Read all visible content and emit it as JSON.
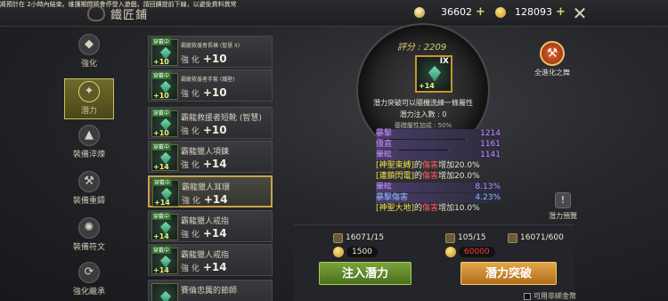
{
  "notice": "將預計在 2小時內結束。維護期間將會停發入遊戲，請回饋提前下線，以避免資料異常",
  "shop_title": "鐵匠鋪",
  "currency": {
    "silver": "36602",
    "gold": "128093"
  },
  "nav": [
    {
      "label": "強化",
      "icon": "gem-icon"
    },
    {
      "label": "潛力",
      "icon": "potential-icon"
    },
    {
      "label": "裝備淬煉",
      "icon": "anvil-icon"
    },
    {
      "label": "裝備重鑄",
      "icon": "hammer-icon"
    },
    {
      "label": "裝備符文",
      "icon": "rune-icon"
    },
    {
      "label": "強化繼承",
      "icon": "inherit-icon"
    }
  ],
  "list": [
    {
      "badge": "穿戴中",
      "lv": "+10",
      "name": "霸龍救援者長褲 (智慧 II)",
      "value_label": "強 化",
      "value": "+10"
    },
    {
      "badge": "穿戴中",
      "lv": "+10",
      "name": "霸龍救援者手套 (鐵壁)",
      "value_label": "強 化",
      "value": "+10"
    },
    {
      "badge": "穿戴中",
      "lv": "+10",
      "name": "霸龍救援者短靴 (智慧)",
      "value_label": "強 化",
      "value": "+10"
    },
    {
      "badge": "穿戴中",
      "lv": "+14",
      "name": "霸龍獵人項鍊",
      "value_label": "強 化",
      "value": "+14"
    },
    {
      "badge": "穿戴中",
      "lv": "+14",
      "name": "霸龍獵人耳環",
      "value_label": "強 化",
      "value": "+14"
    },
    {
      "badge": "穿戴中",
      "lv": "+14",
      "name": "霸龍獵人戒指",
      "value_label": "強 化",
      "value": "+14"
    },
    {
      "badge": "穿戴中",
      "lv": "+14",
      "name": "霸龍獵人戒指",
      "value_label": "強 化",
      "value": "+14"
    },
    {
      "badge": "",
      "lv": "",
      "name": "賽倫忠厲的節師",
      "value_label": "",
      "value": ""
    }
  ],
  "score_label": "評分 : ",
  "score": "2209",
  "equip": {
    "roman": "IX",
    "lv": "+14"
  },
  "desc": "潛力突破可以隨機洗練一條屬性",
  "injected_label": "潛力注入數 : ",
  "injected_value": "0",
  "base_bonus_label": "基礎屬性加成 : ",
  "base_bonus_value": "50%",
  "stats": [
    {
      "label": "暴擊",
      "value": "1214"
    },
    {
      "label": "僵直",
      "value": "1161"
    },
    {
      "label": "暈眩",
      "value": "1141"
    }
  ],
  "effects": [
    {
      "pre": "[神聖束縛]",
      "mid": "的",
      "hl": "傷害",
      "post": "增加20.0%"
    },
    {
      "pre": "[連鎖閃電]",
      "mid": "的",
      "hl": "傷害",
      "post": "增加20.0%"
    },
    {
      "label": "暈眩",
      "value": "8.13%"
    },
    {
      "label": "暴擊傷害",
      "value": "4.23%"
    },
    {
      "pre": "[神聖大地]",
      "mid": "的",
      "hl": "傷害",
      "post": "增加10.0%"
    }
  ],
  "upgrade_all_label": "全進化之舞",
  "preview_label": "潛力預覽",
  "costs": {
    "inject_item": "16071/15",
    "inject_gold": "1500",
    "break_item1": "105/15",
    "break_item2": "16071/600",
    "break_gold": "60000"
  },
  "inject_button": "注入潛力",
  "break_button": "潛力突破",
  "checkbox_label": "可用非綁金幣",
  "colors": {
    "accent_green": "#7aa33a",
    "accent_orange": "#e3a64a",
    "insufficient": "#ff3b3b"
  }
}
